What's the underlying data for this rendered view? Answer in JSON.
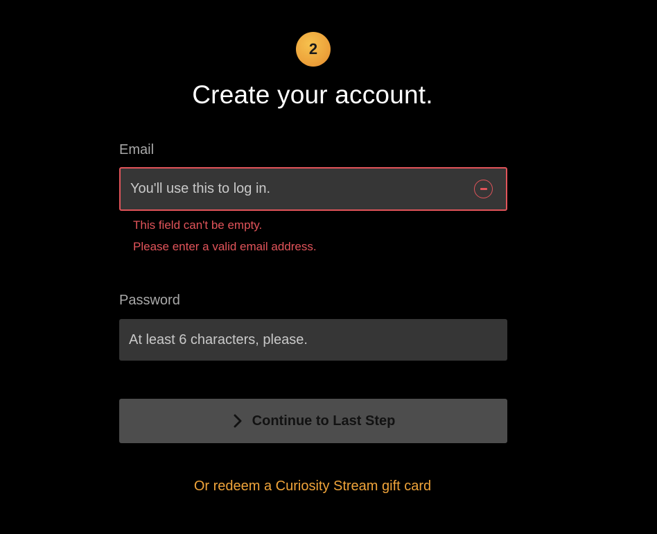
{
  "step": {
    "number": "2"
  },
  "heading": "Create your account.",
  "email": {
    "label": "Email",
    "placeholder": "You'll use this to log in.",
    "value": "",
    "errors": [
      "This field can't be empty.",
      "Please enter a valid email address."
    ],
    "icon": "error-minus-circle-icon"
  },
  "password": {
    "label": "Password",
    "placeholder": "At least 6 characters, please.",
    "value": ""
  },
  "continue_button": {
    "label": "Continue to Last Step",
    "icon": "chevron-right-icon"
  },
  "gift_link": "Or redeem a Curiosity Stream gift card",
  "colors": {
    "background": "#000000",
    "accent": "#f0a43a",
    "error": "#e2545a",
    "input_bg": "#363636",
    "button_bg": "#4d4d4d"
  }
}
